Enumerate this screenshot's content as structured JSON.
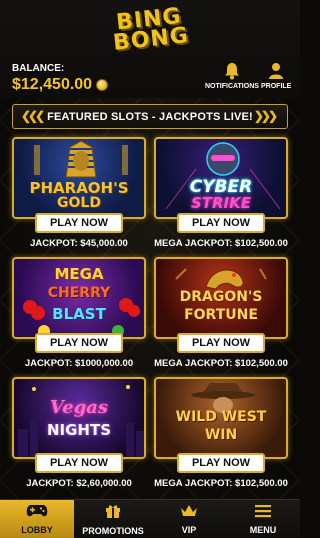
{
  "brand": {
    "logo_line1": "BING",
    "logo_line2": "BONG"
  },
  "header": {
    "balance_label": "BALANCE:",
    "balance_value": "$12,450.00",
    "notifications_label": "NOTIFICATIONS",
    "profile_label": "PROFILE"
  },
  "banner": {
    "text": "FEATURED SLOTS - JACKPOTS LIVE!"
  },
  "games": [
    {
      "title_line1": "PHARAOH'S",
      "title_line2": "GOLD",
      "button": "PLAY NOW",
      "jackpot": "JACKPOT: $45,000.00"
    },
    {
      "title_line1": "CYBER",
      "title_line2": "STRIKE",
      "button": "PLAY NOW",
      "jackpot": "MEGA JACKPOT: $102,500.00"
    },
    {
      "title_line1": "MEGA",
      "title_line2": "CHERRY",
      "title_line3": "BLAST",
      "button": "PLAY NOW",
      "jackpot": "JACKPOT: $1000,000.00"
    },
    {
      "title_line1": "DRAGON'S",
      "title_line2": "FORTUNE",
      "button": "PLAY NOW",
      "jackpot": "MEGA JACKPOT: $102,500.00"
    },
    {
      "title_line1": "Vegas",
      "title_line2": "NIGHTS",
      "button": "PLAY NOW",
      "jackpot": "JACKPOT: $2,60,000.00"
    },
    {
      "title_line1": "WILD WEST",
      "title_line2": "WIN",
      "button": "PLAY NOW",
      "jackpot": "MEGA JACKPOT: $102,500.00"
    }
  ],
  "nav": [
    {
      "label": "LOBBY",
      "icon": "gamepad-icon",
      "active": true
    },
    {
      "label": "PROMOTIONS",
      "icon": "gift-icon",
      "active": false
    },
    {
      "label": "VIP",
      "icon": "crown-icon",
      "active": false
    },
    {
      "label": "MENU",
      "icon": "hamburger-icon",
      "active": false
    }
  ],
  "colors": {
    "accent": "#e9b82b",
    "background": "#0b0a08",
    "gold_text": "#f3c623"
  }
}
